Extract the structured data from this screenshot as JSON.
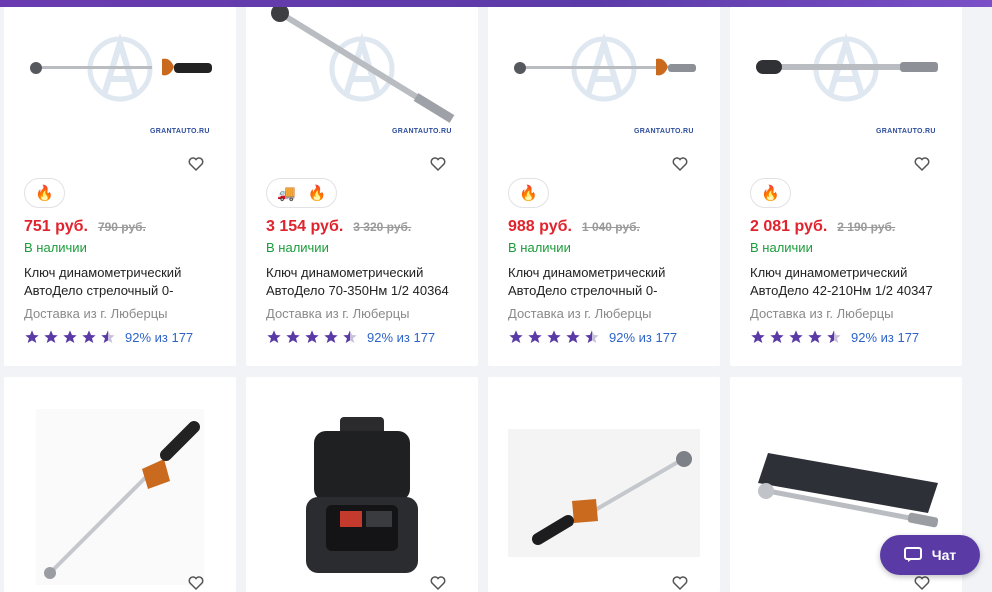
{
  "colors": {
    "price": "#e0242e",
    "in_stock": "#1a9c3a",
    "star": "#5a3ba6",
    "link": "#2e64c8",
    "accent": "#5c3ba8"
  },
  "watermark": {
    "brand": "GRANTAUTO",
    "suffix": ".RU"
  },
  "products": [
    {
      "price": "751 руб.",
      "old_price": "790 руб.",
      "availability": "В наличии",
      "title": "Ключ динамометрический АвтоДело стрелочный 0-",
      "delivery": "Доставка из г. Люберцы",
      "rating": "92% из 177",
      "badges": [
        "fire-icon"
      ]
    },
    {
      "price": "3 154 руб.",
      "old_price": "3 320 руб.",
      "availability": "В наличии",
      "title": "Ключ динамометрический АвтоДело 70-350Нм 1/2 40364",
      "delivery": "Доставка из г. Люберцы",
      "rating": "92% из 177",
      "badges": [
        "truck-icon",
        "fire-icon"
      ]
    },
    {
      "price": "988 руб.",
      "old_price": "1 040 руб.",
      "availability": "В наличии",
      "title": "Ключ динамометрический АвтоДело стрелочный 0-",
      "delivery": "Доставка из г. Люберцы",
      "rating": "92% из 177",
      "badges": [
        "fire-icon"
      ]
    },
    {
      "price": "2 081 руб.",
      "old_price": "2 190 руб.",
      "availability": "В наличии",
      "title": "Ключ динамометрический АвтоДело 42-210Нм 1/2 40347",
      "delivery": "Доставка из г. Люберцы",
      "rating": "92% из 177",
      "badges": [
        "fire-icon"
      ]
    }
  ],
  "second_row": [
    {
      "image": "beam-torque-wrench-photo"
    },
    {
      "image": "digital-torque-adapter-case-photo"
    },
    {
      "image": "beam-torque-wrench-angled-photo"
    },
    {
      "image": "click-torque-wrench-with-case-photo"
    }
  ],
  "chat": {
    "label": "Чат"
  }
}
